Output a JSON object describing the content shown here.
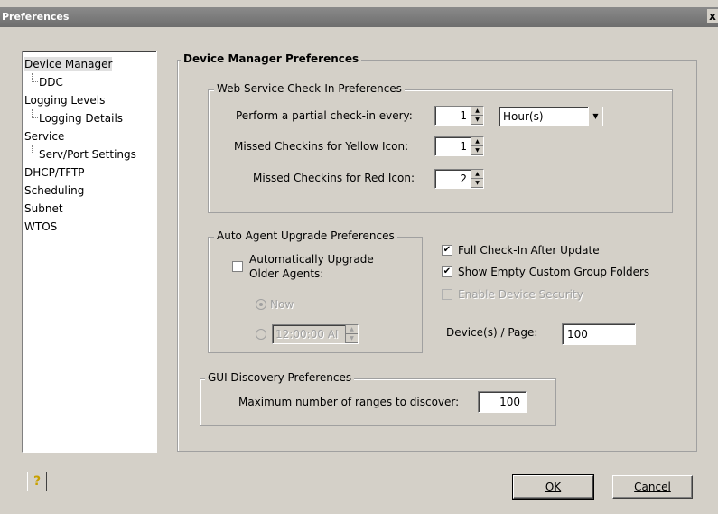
{
  "window": {
    "title": "Preferences",
    "close": "x"
  },
  "tree": {
    "items": [
      {
        "label": "Device Manager"
      },
      {
        "label": "DDC"
      },
      {
        "label": "Logging Levels"
      },
      {
        "label": "Logging Details"
      },
      {
        "label": "Service"
      },
      {
        "label": "Serv/Port Settings"
      },
      {
        "label": "DHCP/TFTP"
      },
      {
        "label": "Scheduling"
      },
      {
        "label": "Subnet"
      },
      {
        "label": "WTOS"
      }
    ]
  },
  "main": {
    "heading": "Device Manager Preferences",
    "web_service": {
      "title": "Web Service Check-In Preferences",
      "partial_label": "Perform a partial check-in every:",
      "partial_value": "1",
      "unit_value": "Hour(s)",
      "yellow_label": "Missed Checkins for Yellow Icon:",
      "yellow_value": "1",
      "red_label": "Missed Checkins for Red Icon:",
      "red_value": "2"
    },
    "auto_agent": {
      "title": "Auto Agent Upgrade Preferences",
      "auto_upgrade_label_1": "Automatically Upgrade",
      "auto_upgrade_label_2": "Older Agents:",
      "now_label": "Now",
      "time_value": "12:00:00 AI"
    },
    "options": {
      "full_checkin_label": "Full Check-In After Update",
      "show_empty_label": "Show Empty Custom Group Folders",
      "enable_security_label": "Enable Device Security",
      "devices_page_label": "Device(s) / Page:",
      "devices_page_value": "100"
    },
    "gui_discovery": {
      "title": "GUI Discovery Preferences",
      "max_ranges_label": "Maximum number of ranges to discover:",
      "max_ranges_value": "100"
    }
  },
  "footer": {
    "help_icon": "?",
    "ok_label": "OK",
    "cancel_label": "Cancel"
  }
}
